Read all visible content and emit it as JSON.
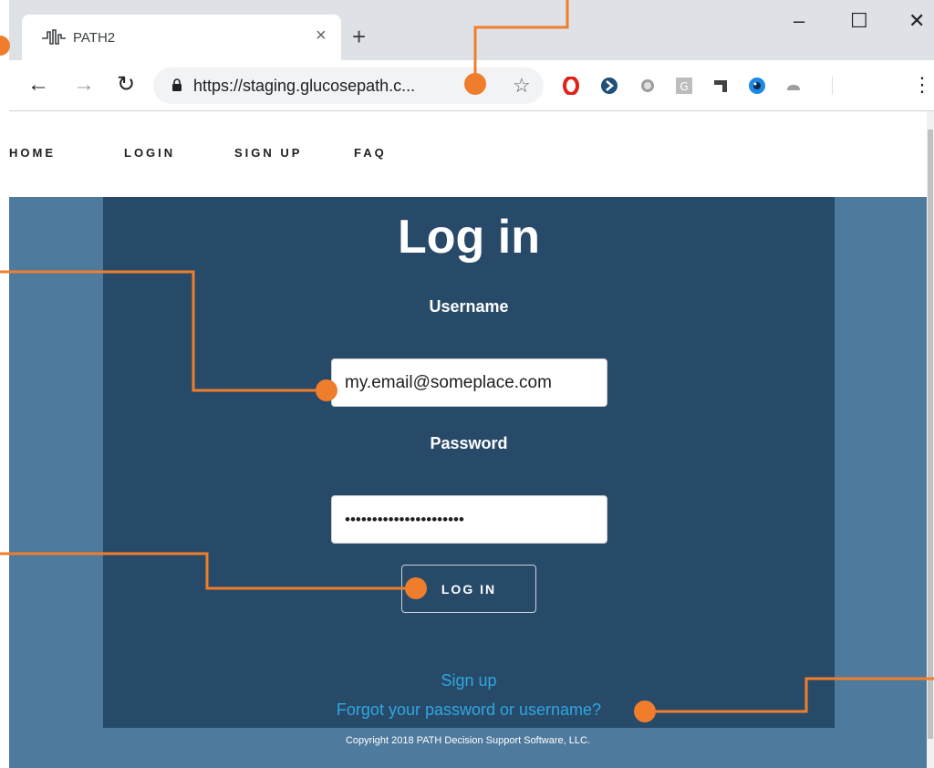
{
  "browser": {
    "tab_title": "PATH2",
    "tab_close": "×",
    "new_tab": "+",
    "url": "https://staging.glucosepath.c...",
    "window_controls": {
      "minimize": "–",
      "maximize": "☐",
      "close": "✕"
    },
    "nav": {
      "back": "←",
      "forward": "→",
      "reload": "↻"
    },
    "bookmark": "☆",
    "menu": "⋮",
    "icons": [
      "heart-pulse-icon",
      "lock-icon",
      "star-icon",
      "opera-icon",
      "arrow-extension-icon",
      "circle-extension-icon",
      "g-extension-icon",
      "tetris-extension-icon",
      "eye-extension-icon",
      "cloud-extension-icon",
      "menu-icon"
    ]
  },
  "nav": {
    "items": [
      "HOME",
      "LOGIN",
      "SIGN UP",
      "FAQ"
    ]
  },
  "login": {
    "title": "Log in",
    "username_label": "Username",
    "username_value": "my.email@someplace.com",
    "password_label": "Password",
    "password_value": "••••••••••••••••••••••",
    "button_label": "LOG IN",
    "signup_link": "Sign up",
    "forgot_link": "Forgot your password or username?"
  },
  "footer": {
    "copyright": "Copyright 2018 PATH Decision Support Software, LLC."
  },
  "colors": {
    "accent": "#f07d2c",
    "panel": "#284a69",
    "page_bg": "#4e7a9e",
    "link": "#2fa6e0"
  }
}
